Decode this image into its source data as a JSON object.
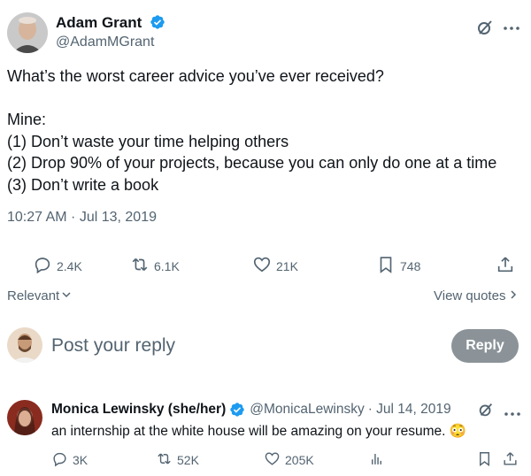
{
  "tweet": {
    "author_name": "Adam Grant",
    "author_handle": "@AdamMGrant",
    "lines": [
      "What’s the worst career advice you’ve ever received?",
      "Mine:",
      "(1) Don’t waste your time helping others",
      "(2) Drop 90% of your projects, because you can only do one at a time",
      "(3) Don’t write a book"
    ],
    "timestamp": "10:27 AM · Jul 13, 2019",
    "stats": {
      "replies": "2.4K",
      "reposts": "6.1K",
      "likes": "21K",
      "bookmarks": "748"
    }
  },
  "filter": {
    "relevant_label": "Relevant",
    "view_quotes_label": "View quotes"
  },
  "reply_box": {
    "placeholder": "Post your reply",
    "button_label": "Reply"
  },
  "reply": {
    "author_name": "Monica Lewinsky (she/her)",
    "author_handle": "@MonicaLewinsky",
    "date": "· Jul 14, 2019",
    "text": "an internship at the white house will be amazing on your resume.",
    "emoji": "😳",
    "stats": {
      "replies": "3K",
      "reposts": "52K",
      "likes": "205K"
    }
  },
  "colors": {
    "verified": "#1d9bf0",
    "muted": "#536471",
    "reply_button": "#8b9399"
  },
  "icons": [
    "verified-badge-icon",
    "grok-icon",
    "more-icon",
    "reply-icon",
    "repost-icon",
    "like-icon",
    "bookmark-icon",
    "share-icon",
    "chevron-down-icon",
    "chevron-right-icon",
    "analytics-icon"
  ]
}
